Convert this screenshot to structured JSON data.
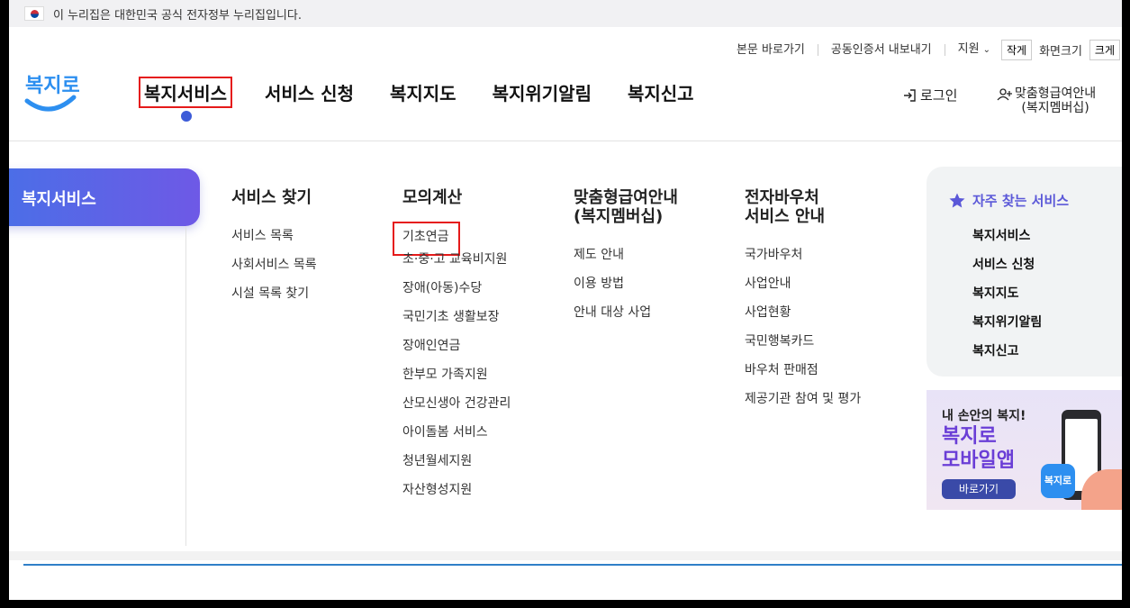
{
  "gov_banner": {
    "text": "이 누리집은 대한민국 공식 전자정부 누리집입니다."
  },
  "utility": {
    "skip": "본문 바로가기",
    "cert": "공동인증서 내보내기",
    "support": "지원",
    "small": "작게",
    "zoom_label": "화면크기",
    "large": "크게"
  },
  "logo": {
    "text": "복지로"
  },
  "gnb": [
    {
      "label": "복지서비스"
    },
    {
      "label": "서비스 신청"
    },
    {
      "label": "복지지도"
    },
    {
      "label": "복지위기알림"
    },
    {
      "label": "복지신고"
    }
  ],
  "account": {
    "login": "로그인",
    "member_line1": "맞춤형급여안내",
    "member_line2": "(복지멤버십)"
  },
  "side_tab": "복지서비스",
  "columns": [
    {
      "title": "서비스 찾기",
      "items": [
        "서비스 목록",
        "사회서비스 목록",
        "시설 목록 찾기"
      ]
    },
    {
      "title": "모의계산",
      "items": [
        "기초연금",
        "초·중·고 교육비지원",
        "장애(아동)수당",
        "국민기초 생활보장",
        "장애인연금",
        "한부모 가족지원",
        "산모신생아 건강관리",
        "아이돌봄 서비스",
        "청년월세지원",
        "자산형성지원"
      ]
    },
    {
      "title_line1": "맞춤형급여안내",
      "title_line2": "(복지멤버십)",
      "items": [
        "제도 안내",
        "이용 방법",
        "안내 대상 사업"
      ]
    },
    {
      "title_line1": "전자바우처",
      "title_line2": "서비스 안내",
      "items": [
        "국가바우처",
        "사업안내",
        "사업현황",
        "국민행복카드",
        "바우처 판매점",
        "제공기관 참여 및 평가"
      ]
    }
  ],
  "favorites": {
    "title": "자주 찾는 서비스",
    "items": [
      "복지서비스",
      "서비스 신청",
      "복지지도",
      "복지위기알림",
      "복지신고"
    ]
  },
  "app_banner": {
    "line1": "내 손안의 복지!",
    "line2": "복지로",
    "line3": "모바일앱",
    "button": "바로가기",
    "icon_text": "복지로"
  },
  "colors": {
    "accent": "#5b58d8",
    "highlight": "#e51a1a",
    "brand_blue": "#2f7fc8"
  }
}
